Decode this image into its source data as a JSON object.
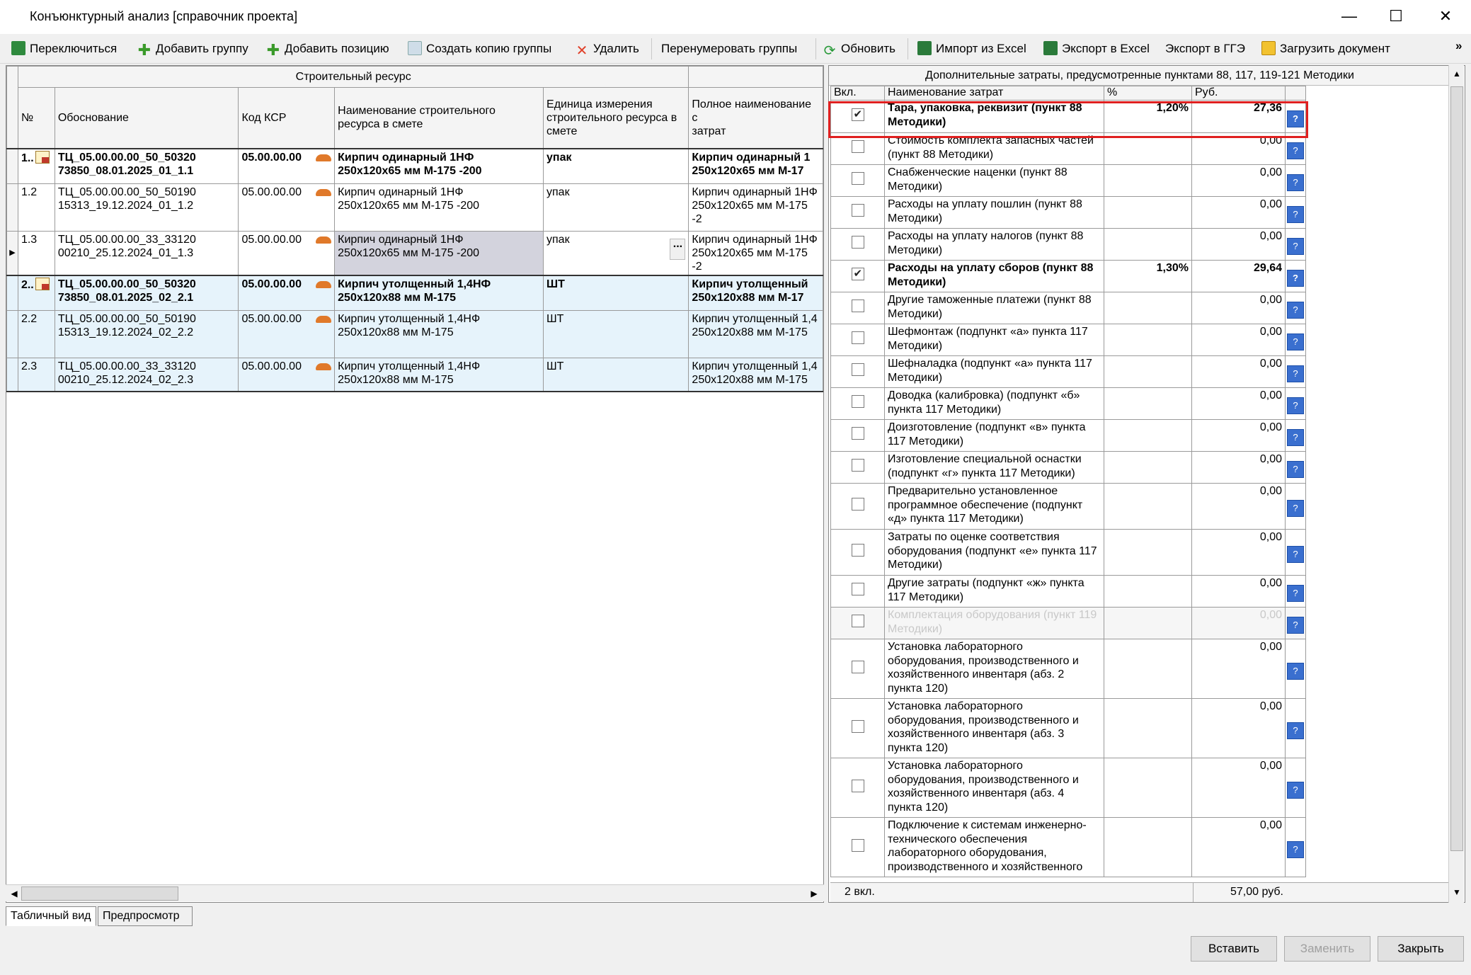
{
  "window": {
    "title": "Конъюнктурный анализ [справочник проекта]",
    "minimize": "—",
    "maximize": "☐",
    "close": "✕"
  },
  "toolbar": {
    "switch": "Переключиться",
    "add_group": "Добавить группу",
    "add_position": "Добавить позицию",
    "copy_group": "Создать копию группы",
    "delete": "Удалить",
    "renumber": "Перенумеровать группы",
    "refresh": "Обновить",
    "import_excel": "Импорт из Excel",
    "export_excel": "Экспорт в Excel",
    "export_gge": "Экспорт в ГГЭ",
    "load_doc": "Загрузить документ",
    "overflow": "»"
  },
  "grid": {
    "group_header": "Строительный ресурс",
    "columns": {
      "num": "№",
      "basis": "Обоснование",
      "ksr": "Код КСР",
      "name": "Наименование строительного\nресурса в смете",
      "unit": "Единица измерения\nстроительного ресурса в\nсмете",
      "full_name": "Полное наименование с\nзатрат"
    },
    "rows": [
      {
        "num": "1..",
        "basis": "ТЦ_05.00.00.00_50_50320\n73850_08.01.2025_01_1.1",
        "ksr": "05.00.00.00",
        "name": "Кирпич одинарный 1НФ\n250х120х65 мм М-175 -200",
        "unit": "упак",
        "full_name": "Кирпич одинарный 1\n250х120х65 мм М-17"
      },
      {
        "num": "1.2",
        "basis": "ТЦ_05.00.00.00_50_50190\n15313_19.12.2024_01_1.2",
        "ksr": "05.00.00.00",
        "name": "Кирпич одинарный 1НФ\n250х120х65 мм М-175 -200",
        "unit": "упак",
        "full_name": "Кирпич одинарный 1НФ\n250х120х65 мм М-175 -2"
      },
      {
        "num": "1.3",
        "basis": "ТЦ_05.00.00.00_33_33120\n00210_25.12.2024_01_1.3",
        "ksr": "05.00.00.00",
        "name": "Кирпич одинарный 1НФ\n250х120х65 мм М-175 -200",
        "unit": "упак",
        "full_name": "Кирпич одинарный 1НФ\n250х120х65 мм М-175 -2"
      },
      {
        "num": "2..",
        "basis": "ТЦ_05.00.00.00_50_50320\n73850_08.01.2025_02_2.1",
        "ksr": "05.00.00.00",
        "name": "Кирпич утолщенный 1,4НФ\n250х120х88 мм М-175",
        "unit": "ШТ",
        "full_name": "Кирпич утолщенный\n250х120х88 мм М-17"
      },
      {
        "num": "2.2",
        "basis": "ТЦ_05.00.00.00_50_50190\n15313_19.12.2024_02_2.2",
        "ksr": "05.00.00.00",
        "name": "Кирпич утолщенный 1,4НФ\n250х120х88 мм М-175",
        "unit": "ШТ",
        "full_name": "Кирпич утолщенный 1,4\n250х120х88 мм М-175"
      },
      {
        "num": "2.3",
        "basis": "ТЦ_05.00.00.00_33_33120\n00210_25.12.2024_02_2.3",
        "ksr": "05.00.00.00",
        "name": "Кирпич утолщенный 1,4НФ\n250х120х88 мм М-175",
        "unit": "ШТ",
        "full_name": "Кирпич утолщенный 1,4\n250х120х88 мм М-175"
      }
    ],
    "edit_button": "..."
  },
  "costs": {
    "title": "Дополнительные затраты, предусмотренные пунктами 88, 117, 119-121 Методики",
    "columns": {
      "on": "Вкл.",
      "name": "Наименование затрат",
      "pct": "%",
      "rub": "Руб."
    },
    "rows": [
      {
        "name": "Тара, упаковка, реквизит (пункт 88 Методики)",
        "pct": "1,20%",
        "rub": "27,36",
        "checked": true
      },
      {
        "name": "Стоимость комплекта запасных частей (пункт 88 Методики)",
        "pct": "",
        "rub": "0,00",
        "checked": false
      },
      {
        "name": "Снабженческие наценки (пункт 88 Методики)",
        "pct": "",
        "rub": "0,00",
        "checked": false
      },
      {
        "name": "Расходы на уплату пошлин (пункт 88 Методики)",
        "pct": "",
        "rub": "0,00",
        "checked": false
      },
      {
        "name": "Расходы на уплату налогов (пункт 88 Методики)",
        "pct": "",
        "rub": "0,00",
        "checked": false
      },
      {
        "name": "Расходы на уплату сборов (пункт 88 Методики)",
        "pct": "1,30%",
        "rub": "29,64",
        "checked": true
      },
      {
        "name": "Другие таможенные платежи (пункт 88 Методики)",
        "pct": "",
        "rub": "0,00",
        "checked": false
      },
      {
        "name": "Шефмонтаж (подпункт «а» пункта 117 Методики)",
        "pct": "",
        "rub": "0,00",
        "checked": false
      },
      {
        "name": "Шефналадка (подпункт «а» пункта 117 Методики)",
        "pct": "",
        "rub": "0,00",
        "checked": false
      },
      {
        "name": "Доводка (калибровка) (подпункт «б» пункта 117 Методики)",
        "pct": "",
        "rub": "0,00",
        "checked": false
      },
      {
        "name": "Доизготовление (подпункт «в» пункта 117 Методики)",
        "pct": "",
        "rub": "0,00",
        "checked": false
      },
      {
        "name": "Изготовление специальной оснастки (подпункт «г» пункта 117 Методики)",
        "pct": "",
        "rub": "0,00",
        "checked": false
      },
      {
        "name": "Предварительно установленное программное обеспечение (подпункт «д» пункта 117 Методики)",
        "pct": "",
        "rub": "0,00",
        "checked": false
      },
      {
        "name": "Затраты по оценке соответствия оборудования (подпункт «е» пункта 117 Методики)",
        "pct": "",
        "rub": "0,00",
        "checked": false
      },
      {
        "name": "Другие затраты (подпункт «ж» пункта 117 Методики)",
        "pct": "",
        "rub": "0,00",
        "checked": false
      },
      {
        "name": "Комплектация оборудования (пункт 119 Методики)",
        "pct": "",
        "rub": "0,00",
        "checked": false
      },
      {
        "name": "Установка лабораторного оборудования, производственного и хозяйственного инвентаря (абз. 2 пункта 120)",
        "pct": "",
        "rub": "0,00",
        "checked": false
      },
      {
        "name": "Установка лабораторного оборудования, производственного и хозяйственного инвентаря (абз. 3 пункта 120)",
        "pct": "",
        "rub": "0,00",
        "checked": false
      },
      {
        "name": "Установка лабораторного оборудования, производственного и хозяйственного инвентаря (абз. 4 пункта 120)",
        "pct": "",
        "rub": "0,00",
        "checked": false
      },
      {
        "name": "Подключение к системам инженерно-технического обеспечения лабораторного оборудования, производственного и хозяйственного",
        "pct": "",
        "rub": "0,00",
        "checked": false
      }
    ],
    "help": "?",
    "footer_count": "2 вкл.",
    "footer_sum": "57,00 руб."
  },
  "tabs": {
    "table_view": "Табличный вид",
    "preview": "Предпросмотр"
  },
  "buttons": {
    "insert": "Вставить",
    "replace": "Заменить",
    "close": "Закрыть"
  },
  "colors": {
    "highlight": "#e02020",
    "group_row_bg": "#e6f3fb",
    "help_icon": "#3a6fcf"
  }
}
